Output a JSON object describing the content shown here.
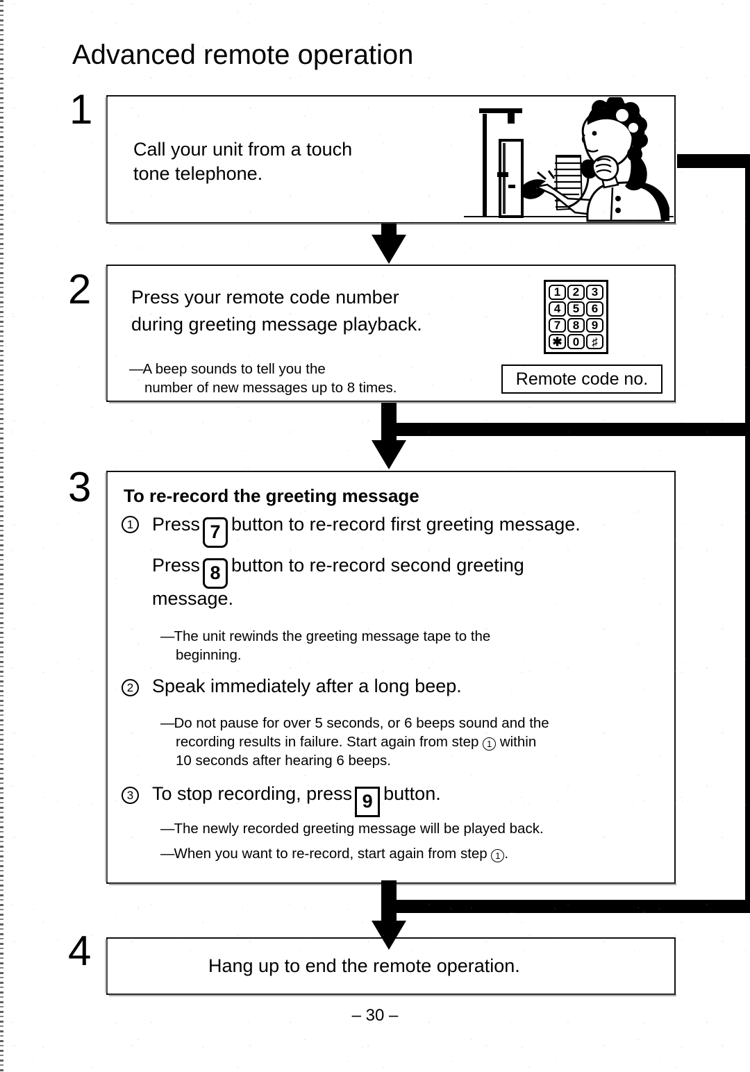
{
  "page": {
    "title": "Advanced remote operation",
    "page_number": "– 30 –"
  },
  "steps": [
    {
      "number": "1",
      "text_line1": "Call your unit from a touch",
      "text_line2": "tone telephone.",
      "illustration": "woman-on-payphone-illustration"
    },
    {
      "number": "2",
      "text_line1": "Press your remote code number",
      "text_line2": "during greeting message playback.",
      "note_line1": "A beep sounds to tell you the",
      "note_line2": "number of new messages up to 8 times.",
      "keypad": {
        "keys": [
          "1",
          "2",
          "3",
          "4",
          "5",
          "6",
          "7",
          "8",
          "9",
          "✱",
          "0",
          "♯"
        ],
        "caption": "Remote code no."
      }
    },
    {
      "number": "3",
      "heading": "To re-record the greeting message",
      "items": [
        {
          "marker": "1",
          "line1_a": "Press",
          "line1_key": "7",
          "line1_b": "button to re-record first greeting message.",
          "line2_a": "Press",
          "line2_key": "8",
          "line2_b": "button to re-record second greeting",
          "line3": "message.",
          "notes": [
            {
              "line1": "The unit rewinds the greeting message tape to the",
              "line2": "beginning."
            }
          ]
        },
        {
          "marker": "2",
          "text": "Speak immediately after a long beep.",
          "notes": [
            {
              "line1": "Do not pause for over 5 seconds, or 6 beeps sound and the",
              "line2_a": "recording results in failure. Start again from step",
              "line2_ref": "1",
              "line2_b": "within",
              "line3": "10 seconds after hearing 6 beeps."
            }
          ]
        },
        {
          "marker": "3",
          "text_a": "To stop recording, press",
          "key": "9",
          "text_b": "button.",
          "notes": [
            {
              "line1": "The newly recorded greeting message will be played back."
            },
            {
              "line1_a": "When you want to re-record, start again from step",
              "line1_ref": "1",
              "line1_b": "."
            }
          ]
        }
      ]
    },
    {
      "number": "4",
      "text": "Hang up to end the remote operation."
    }
  ],
  "flow": {
    "arrow_1_to_2": "down-arrow-icon",
    "arrow_2_to_3": "down-arrow-icon",
    "arrow_3_to_4": "down-arrow-icon",
    "connector_right_1": "connector-bar",
    "connector_right_2": "connector-bar",
    "connector_right_3": "connector-bar"
  },
  "colors": {
    "ink": "#000000",
    "paper": "#ffffff"
  }
}
